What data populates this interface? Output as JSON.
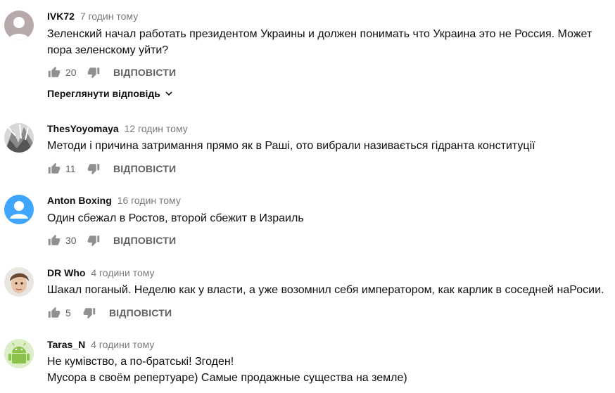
{
  "reply_label": "ВІДПОВІСТИ",
  "comments": [
    {
      "author": "IVK72",
      "time": "7 годин тому",
      "lines": [
        "Зеленский начал работать президентом Украины и должен понимать что Украина это не Россия. Может пора зеленскому уйти?"
      ],
      "likes": "20",
      "view_replies": "Переглянути відповідь",
      "avatar": "default-avatar-icon"
    },
    {
      "author": "ThesYoyomaya",
      "time": "12 годин тому",
      "lines": [
        "Методи і причина затримання прямо як в Раші, ото вибрали називається гідранта конституції"
      ],
      "likes": "11",
      "avatar": "photo-avatar"
    },
    {
      "author": "Anton Boxing",
      "time": "16 годин тому",
      "lines": [
        "Один сбежал в Ростов, второй сбежит в Израиль"
      ],
      "likes": "30",
      "avatar": "person-icon"
    },
    {
      "author": "DR Who",
      "time": "4 години тому",
      "lines": [
        "Шакал поганый. Неделю как  у власти, а уже возомнил себя императором, как карлик в соседней наРосии."
      ],
      "likes": "5",
      "avatar": "face-photo-avatar"
    },
    {
      "author": "Taras_N",
      "time": "4 години тому",
      "lines": [
        "Не кумівство, а по-братські!  Згоден!",
        "Мусора в своём репертуаре) Самые продажные существа на земле)"
      ],
      "avatar": "android-icon"
    }
  ],
  "colors": {
    "secondary_text": "#606060",
    "timestamp": "#7a7a7a",
    "avatar_gray": "#b0a8a8",
    "avatar_blue": "#3ea6ff",
    "android_green": "#8bc34a"
  }
}
